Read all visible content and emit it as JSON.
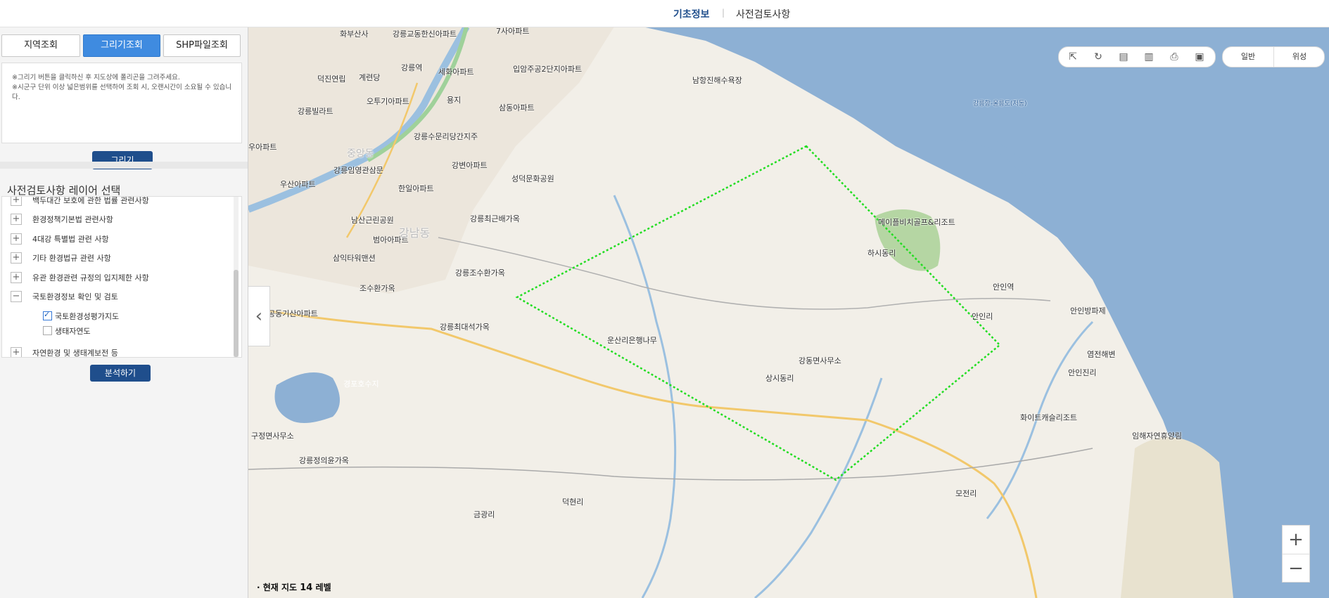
{
  "topnav": {
    "tab1": "기초정보",
    "separator": "|",
    "tab2": "사전검토사항"
  },
  "left_panel": {
    "tabs": [
      "지역조회",
      "그리기조회",
      "SHP파일조회"
    ],
    "draw_note_line1": "※그리기 버튼을 클릭하신 후 지도상에 폴리곤을 그려주세요.",
    "draw_note_line2": "※시군구 단위 이상 넓은범위를 선택하여 조회 시, 오랜시간이 소요될 수 있습니다.",
    "draw_button": "그리기",
    "layer_title": "사전검토사항 레이어 선택",
    "layers": [
      {
        "sign": "+",
        "label": "백두대간 보호에 관한 법률 관련사항"
      },
      {
        "sign": "+",
        "label": "환경정책기본법 관련사항"
      },
      {
        "sign": "+",
        "label": "4대강 특별법 관련 사항"
      },
      {
        "sign": "+",
        "label": "기타 환경법규 관련 사항"
      },
      {
        "sign": "+",
        "label": "유관 환경관련 규정의 입지제한 사항"
      },
      {
        "sign": "−",
        "label": "국토환경정보 확인 및 검토"
      },
      {
        "sign": "+",
        "label": "자연환경 및 생태계보전 등"
      }
    ],
    "sub_layers": [
      {
        "label": "국토환경성평가지도",
        "checked": true
      },
      {
        "label": "생태자연도",
        "checked": false
      }
    ],
    "analyze_button": "분석하기"
  },
  "map": {
    "collapse_icon": "chevron-left-icon",
    "toolbar_icons": [
      "export-icon",
      "refresh-icon",
      "ruler-icon",
      "area-icon",
      "print-icon",
      "screen-icon"
    ],
    "modes": [
      "일반",
      "위성"
    ],
    "zoom_in": "+",
    "zoom_out": "−",
    "level_label": "· 현재 지도",
    "level_value": "14",
    "level_unit": "레벨",
    "polygon_color": "#22dd22",
    "labels": [
      "화부산사",
      "강릉교동한신아파트",
      "7사아파트",
      "강릉역",
      "세화아파트",
      "입암주공2단지아파트",
      "덕진연립",
      "계련당",
      "오투기아파트",
      "용지",
      "삼동아파트",
      "강릉빌라트",
      "강릉수문리당간지주",
      "우아파트",
      "강변아파트",
      "강릉임영관삼문",
      "성덕문화공원",
      "우산아파트",
      "한일아파트",
      "남산근린공원",
      "강릉최근배가옥",
      "범아아파트",
      "삼익타워맨션",
      "강릉조수환가옥",
      "조수환가옥",
      "공동기산아파트",
      "강릉최대석가옥",
      "경포호수지",
      "운산리은행나무",
      "강동면사무소",
      "메이플비치골프&리조트",
      "하시동리",
      "안인역",
      "안인리",
      "안인방파제",
      "염전해변",
      "안인진리",
      "상시동리",
      "화이트캐슬리조트",
      "임해자연휴양림",
      "구정면사무소",
      "강릉정의윤가옥",
      "덕현리",
      "금광리",
      "모전리",
      "남항진해수욕장",
      "강릉항-울릉도(저동)",
      "강남동",
      "중앙동"
    ]
  }
}
